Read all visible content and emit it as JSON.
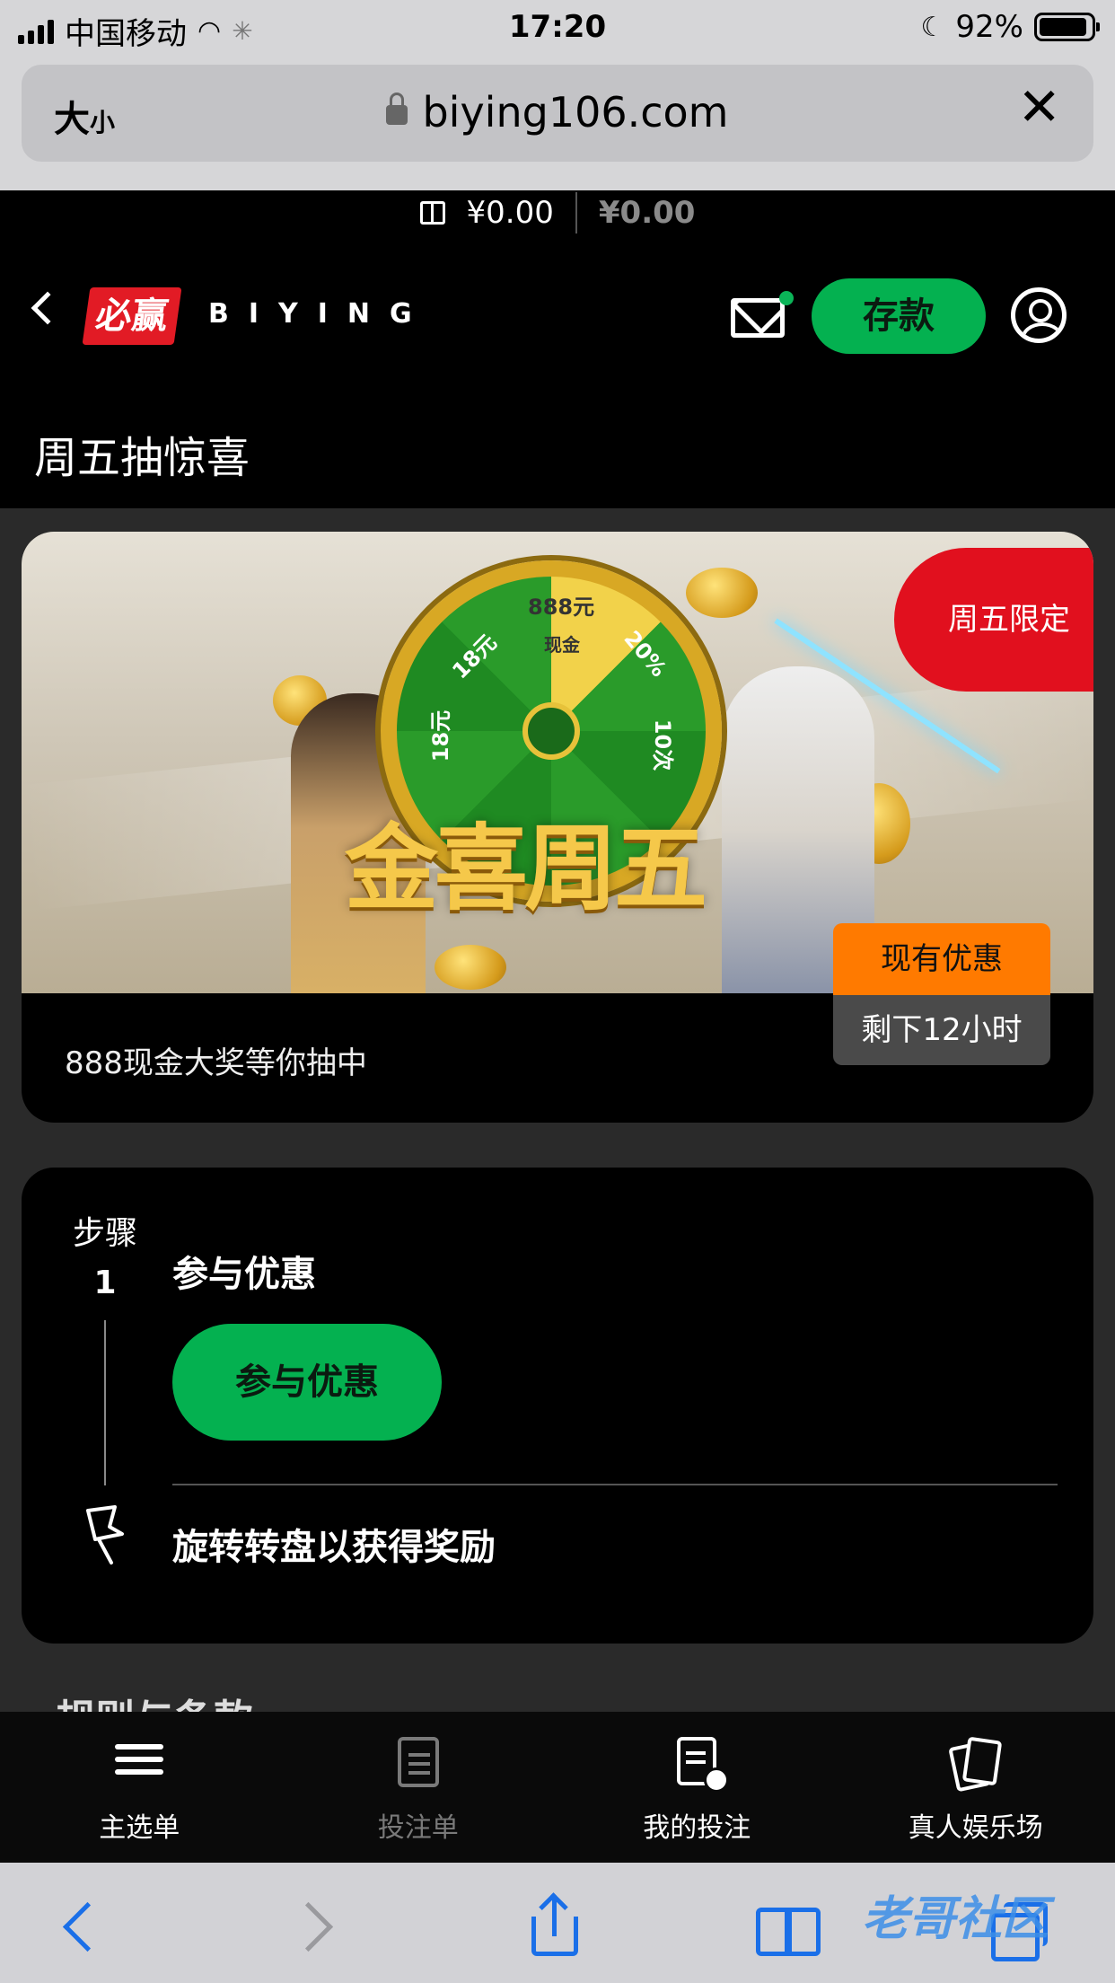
{
  "status_bar": {
    "carrier": "中国移动",
    "time": "17:20",
    "battery": "92%",
    "battery_level": 0.92
  },
  "browser": {
    "text_size_label": "大",
    "text_size_small": "小",
    "url": "biying106.com"
  },
  "site": {
    "balance_main": "¥0.00",
    "balance_bonus": "¥0.00",
    "logo_text": "必赢",
    "brand_name": "BIYING",
    "deposit_label": "存款",
    "page_title": "周五抽惊喜"
  },
  "promo": {
    "banner_title": "金喜周五",
    "wheel_labels": [
      "888元",
      "现金",
      "20%",
      "10次",
      "18元",
      "18元"
    ],
    "tag_friday": "周五限定",
    "tag_offer": "现有优惠",
    "tag_remaining": "剩下12小时",
    "description": "888现金大奖等你抽中"
  },
  "steps": {
    "step_word": "步骤",
    "step_number": "1",
    "step_title": "参与优惠",
    "join_button": "参与优惠",
    "final_step": "旋转转盘以获得奖励"
  },
  "terms_heading": "规则与条款",
  "tab_bar": [
    {
      "label": "主选单",
      "icon": "menu-icon"
    },
    {
      "label": "投注单",
      "icon": "betslip-icon"
    },
    {
      "label": "我的投注",
      "icon": "my-bets-icon"
    },
    {
      "label": "真人娱乐场",
      "icon": "live-casino-icon"
    }
  ],
  "colors": {
    "accent_green": "#04b150",
    "tag_red": "#e1101e",
    "tag_orange": "#ff7a00",
    "ios_blue": "#1a6fe8"
  }
}
